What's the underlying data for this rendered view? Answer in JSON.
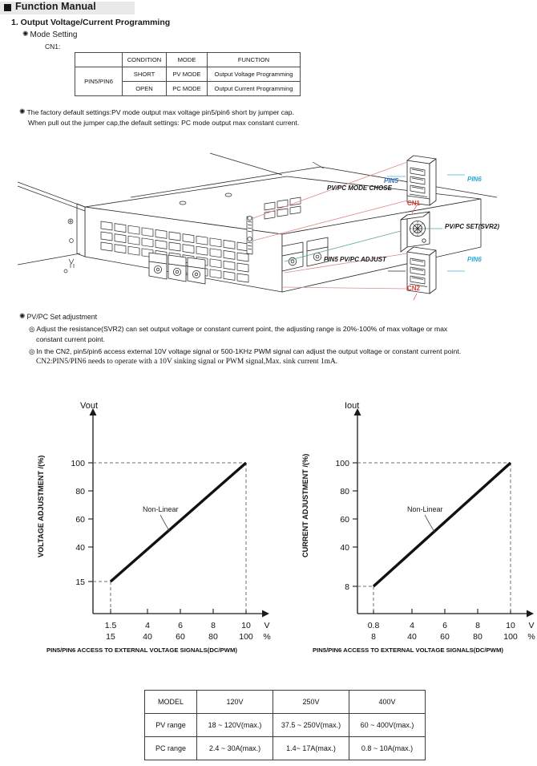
{
  "header": {
    "title": "Function Manual",
    "section_title": "1. Output Voltage/Current Programming",
    "mode_setting": "Mode Setting",
    "cn1_label": "CN1:"
  },
  "mode_table": {
    "headers": [
      "",
      "CONDITION",
      "MODE",
      "FUNCTION"
    ],
    "row_label": "PIN5/PIN6",
    "rows": [
      {
        "condition": "SHORT",
        "mode": "PV MODE",
        "function": "Output Voltage Programming"
      },
      {
        "condition": "OPEN",
        "mode": "PC MODE",
        "function": "Output Current Programming"
      }
    ]
  },
  "notes": {
    "factory_line1": "The factory default settings:PV mode output max voltage pin5/pin6 short by jumper cap.",
    "factory_line2": "When pull out the jumper cap,the default settings: PC mode output max constant current."
  },
  "diagram": {
    "callouts": {
      "pin5_top": "PIN5",
      "pin6_top": "PIN6",
      "mode_chose": "PV/PC MODE CHOSE",
      "cn1": "CN1",
      "svr2": "PV/PC SET(SVR2)",
      "pin5_bottom": "PIN5  PV/PC ADJUST",
      "pin6_bottom": "PIN6",
      "cn2": "CN2"
    },
    "colors": {
      "pin_blue": "#2f6fc0",
      "pin_cyan": "#27a8d8",
      "connector_red": "#e03a2f",
      "leader_red": "#e08080",
      "leader_green": "#4fa07a"
    }
  },
  "adjustment": {
    "heading": "PV/PC Set adjustment",
    "bullet1_line1": "Adjust the resistance(SVR2) can set output voltage or constant current point, the adjusting range is 20%-100% of max voltage or max",
    "bullet1_line2": "constant current point.",
    "bullet2_line1": "In the CN2, pin5/pin6  access external 10V voltage signal or 500-1KHz PWM signal can adjust the output voltage or constant current point.",
    "bullet2_line2": "CN2:PIN5/PIN6 needs to operate with a 10V sinking signal or PWM signal,Max. sink current 1mA."
  },
  "chart_data": [
    {
      "type": "line",
      "title": "Vout",
      "ylabel": "VOLTAGE ADJUSTMENT /(%)",
      "x_unit": "V",
      "y_unit_row": "%",
      "x_ticks_top": [
        "1.5",
        "4",
        "6",
        "8",
        "10"
      ],
      "x_ticks_bottom": [
        "15",
        "40",
        "60",
        "80",
        "100"
      ],
      "y_ticks": [
        "15",
        "40",
        "60",
        "80",
        "100"
      ],
      "annotation": "Non-Linear",
      "points": [
        {
          "x": 1.5,
          "y": 15
        },
        {
          "x": 10,
          "y": 100
        }
      ],
      "xlim": [
        0,
        11.4
      ],
      "ylim": [
        0,
        115
      ],
      "caption": "PIN5/PIN6 ACCESS TO EXTERNAL VOLTAGE SIGNALS(DC/PWM)",
      "grid": false
    },
    {
      "type": "line",
      "title": "Iout",
      "ylabel": "CURRENT ADJUSTMENT /(%)",
      "x_unit": "V",
      "y_unit_row": "%",
      "x_ticks_top": [
        "0.8",
        "4",
        "6",
        "8",
        "10"
      ],
      "x_ticks_bottom": [
        "8",
        "40",
        "60",
        "80",
        "100"
      ],
      "y_ticks": [
        "8",
        "40",
        "60",
        "80",
        "100"
      ],
      "annotation": "Non-Linear",
      "points": [
        {
          "x": 0.8,
          "y": 8
        },
        {
          "x": 10,
          "y": 100
        }
      ],
      "xlim": [
        0,
        11.4
      ],
      "ylim": [
        0,
        115
      ],
      "caption": "PIN5/PIN6 ACCESS TO EXTERNAL VOLTAGE SIGNALS(DC/PWM)",
      "grid": false
    }
  ],
  "spec_table": {
    "headers": [
      "MODEL",
      "120V",
      "250V",
      "400V"
    ],
    "rows": [
      {
        "label": "PV range",
        "values": [
          "18 ~ 120V(max.)",
          "37.5 ~ 250V(max.)",
          "60 ~ 400V(max.)"
        ]
      },
      {
        "label": "PC range",
        "values": [
          "2.4 ~ 30A(max.)",
          "1.4~ 17A(max.)",
          "0.8 ~ 10A(max.)"
        ]
      }
    ]
  }
}
